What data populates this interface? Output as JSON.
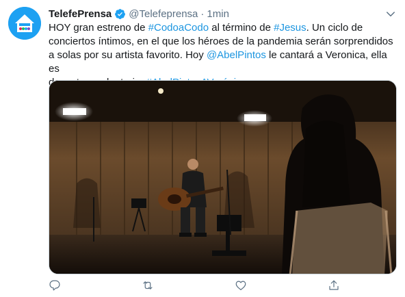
{
  "tweet": {
    "author_name": "TelefePrensa",
    "handle": "@Telefeprensa",
    "separator": "·",
    "time": "1min",
    "avatar_badge_text": "QUEDATE EN CASA",
    "text_segments": [
      {
        "text": "HOY gran estreno de ",
        "type": "text"
      },
      {
        "text": "#CodoaCodo",
        "type": "link"
      },
      {
        "text": " al término de ",
        "type": "text"
      },
      {
        "text": "#Jesus",
        "type": "link"
      },
      {
        "text": ". Un ciclo de\nconciertos íntimos, en el que los héroes de la pandemia serán sorprendidos\na solas por su artista favorito.  Hoy ",
        "type": "text"
      },
      {
        "text": "@AbelPintos",
        "type": "link"
      },
      {
        "text": " le cantará a Veronica, ella es\ndocente y voluntaria. ",
        "type": "text"
      },
      {
        "text": "#AbelPintosAVerónica",
        "type": "link"
      }
    ],
    "link_color": "#1b95e0",
    "verified_color": "#1da1f2",
    "brand_color": "#1da1f2",
    "icons": {
      "more": "chevron-down-icon",
      "reply": "reply-icon",
      "retweet": "retweet-icon",
      "like": "heart-icon",
      "share": "share-icon",
      "verified": "verified-badge-icon"
    }
  }
}
